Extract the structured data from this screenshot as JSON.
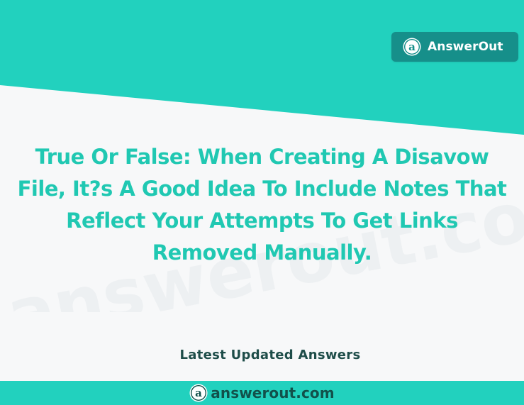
{
  "brand": {
    "name": "AnswerOut",
    "logo_icon": "answerout-logo-icon"
  },
  "question": {
    "text": "True Or False: When Creating A Disavow File, It?s A Good Idea To Include Notes That Reflect Your Attempts To Get Links Removed Manually."
  },
  "section": {
    "latest_label": "Latest Updated Answers"
  },
  "watermark": {
    "text": "answerout.com"
  },
  "footer": {
    "url": "answerout.com",
    "logo_icon": "answerout-logo-icon"
  },
  "colors": {
    "teal_band": "#22d1be",
    "badge_bg": "#168f8a",
    "question_text": "#20c8b2",
    "label_text": "#1e4d49",
    "background": "#f7f8f9"
  }
}
